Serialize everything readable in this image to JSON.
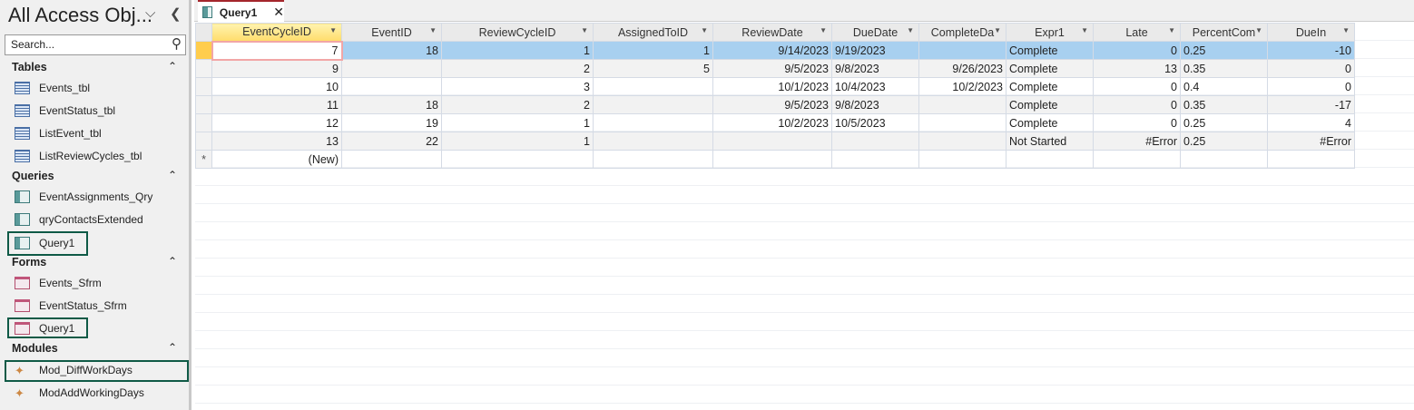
{
  "nav": {
    "title": "All Access Obj...",
    "search_placeholder": "Search...",
    "groups": [
      {
        "label": "Tables",
        "items": [
          {
            "label": "Events_tbl",
            "icon": "table-icon"
          },
          {
            "label": "EventStatus_tbl",
            "icon": "table-icon"
          },
          {
            "label": "ListEvent_tbl",
            "icon": "table-icon"
          },
          {
            "label": "ListReviewCycles_tbl",
            "icon": "table-icon"
          }
        ]
      },
      {
        "label": "Queries",
        "items": [
          {
            "label": "EventAssignments_Qry",
            "icon": "query-icon"
          },
          {
            "label": "qryContactsExtended",
            "icon": "query-icon"
          },
          {
            "label": "Query1",
            "icon": "query-icon"
          }
        ]
      },
      {
        "label": "Forms",
        "items": [
          {
            "label": "Events_Sfrm",
            "icon": "form-icon"
          },
          {
            "label": "EventStatus_Sfrm",
            "icon": "form-icon"
          },
          {
            "label": "Query1",
            "icon": "form-icon"
          }
        ]
      },
      {
        "label": "Modules",
        "items": [
          {
            "label": "Mod_DiffWorkDays",
            "icon": "module-icon"
          },
          {
            "label": "ModAddWorkingDays",
            "icon": "module-icon"
          }
        ]
      }
    ]
  },
  "tab": {
    "label": "Query1"
  },
  "grid": {
    "columns": [
      "EventCycleID",
      "EventID",
      "ReviewCycleID",
      "AssignedToID",
      "ReviewDate",
      "DueDate",
      "CompleteDa",
      "Expr1",
      "Late",
      "PercentCom",
      "DueIn"
    ],
    "rows": [
      [
        "7",
        "18",
        "1",
        "1",
        "9/14/2023",
        "9/19/2023",
        "",
        "Complete",
        "0",
        "0.25",
        "-10"
      ],
      [
        "9",
        "",
        "2",
        "5",
        "9/5/2023",
        "9/8/2023",
        "9/26/2023",
        "Complete",
        "13",
        "0.35",
        "0"
      ],
      [
        "10",
        "",
        "3",
        "",
        "10/1/2023",
        "10/4/2023",
        "10/2/2023",
        "Complete",
        "0",
        "0.4",
        "0"
      ],
      [
        "11",
        "18",
        "2",
        "",
        "9/5/2023",
        "9/8/2023",
        "",
        "Complete",
        "0",
        "0.35",
        "-17"
      ],
      [
        "12",
        "19",
        "1",
        "",
        "10/2/2023",
        "10/5/2023",
        "",
        "Complete",
        "0",
        "0.25",
        "4"
      ],
      [
        "13",
        "22",
        "1",
        "",
        "",
        "",
        "",
        "Not Started",
        "#Error",
        "0.25",
        "#Error"
      ]
    ],
    "new_row_label": "(New)",
    "new_row_marker": "*"
  },
  "colors": {
    "accent": "#a4262c",
    "selection": "#a8d0f0",
    "highlight_box": "#0f5a46"
  }
}
